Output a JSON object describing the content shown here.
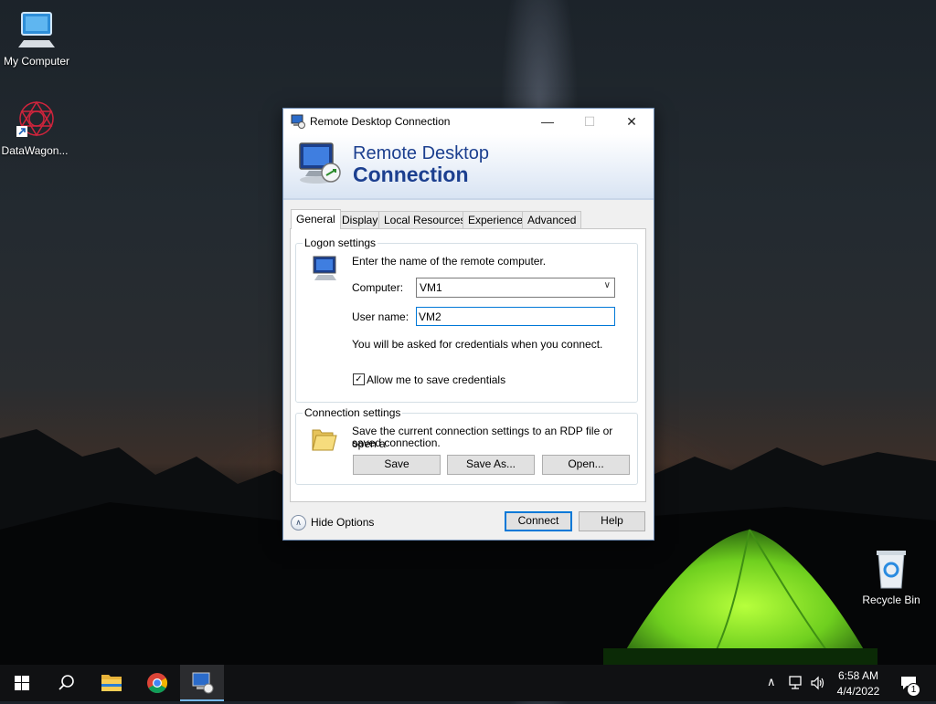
{
  "desktop": {
    "icons": [
      {
        "label": "My Computer",
        "icon": "computer-icon"
      },
      {
        "label": "DataWagon...",
        "icon": "datawagon-shortcut-icon"
      },
      {
        "label": "Recycle Bin",
        "icon": "recycle-bin-icon"
      }
    ]
  },
  "window": {
    "title": "Remote Desktop Connection",
    "controls": {
      "minimize": "—",
      "maximize": "☐",
      "close": "✕"
    },
    "banner": {
      "line1": "Remote Desktop",
      "line2": "Connection"
    },
    "tabs": [
      "General",
      "Display",
      "Local Resources",
      "Experience",
      "Advanced"
    ],
    "active_tab": "General",
    "logon": {
      "legend": "Logon settings",
      "instruction": "Enter the name of the remote computer.",
      "computer_label": "Computer:",
      "computer_value": "VM1",
      "username_label": "User name:",
      "username_value": "VM2",
      "credentials_note": "You will be asked for credentials when you connect.",
      "allow_save_label": "Allow me to save credentials",
      "allow_save_checked": true
    },
    "connection": {
      "legend": "Connection settings",
      "description_line1": "Save the current connection settings to an RDP file or open a",
      "description_line2": "saved connection.",
      "save": "Save",
      "save_as": "Save As...",
      "open": "Open..."
    },
    "hide_options": "Hide Options",
    "connect": "Connect",
    "help": "Help"
  },
  "taskbar": {
    "items": [
      "start-icon",
      "search-icon",
      "file-explorer-icon",
      "chrome-icon",
      "remote-desktop-icon"
    ],
    "time": "6:58 AM",
    "date": "4/4/2022",
    "notification_count": "1"
  }
}
